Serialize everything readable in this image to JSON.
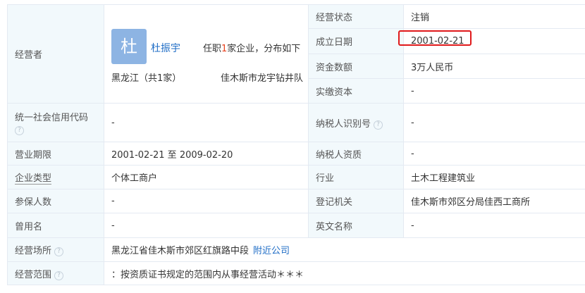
{
  "operator": {
    "label": "经营者",
    "avatar_char": "杜",
    "name": "杜振宇",
    "summary_prefix": "任职",
    "summary_count": "1",
    "summary_suffix": "家企业，分布如下",
    "region": "黑龙江（共1家）",
    "company": "佳木斯市龙宇钻井队"
  },
  "rows": {
    "status": {
      "label": "经营状态",
      "value": "注销"
    },
    "established": {
      "label": "成立日期",
      "value": "2001-02-21"
    },
    "capital": {
      "label": "资金数额",
      "value": "3万人民币"
    },
    "paid_capital": {
      "label": "实缴资本",
      "value": "-"
    },
    "credit_code": {
      "label": "统一社会信用代码",
      "value": "-"
    },
    "taxpayer_id": {
      "label": "纳税人识别号",
      "value": "-"
    },
    "business_term": {
      "label": "营业期限",
      "value": "2001-02-21 至 2009-02-20"
    },
    "taxpayer_qualification": {
      "label": "纳税人资质",
      "value": "-"
    },
    "company_type": {
      "label": "企业类型",
      "value": "个体工商户"
    },
    "industry": {
      "label": "行业",
      "value": "土木工程建筑业"
    },
    "insured_count": {
      "label": "参保人数",
      "value": "-"
    },
    "registration_authority": {
      "label": "登记机关",
      "value": "佳木斯市郊区分局佳西工商所"
    },
    "former_name": {
      "label": "曾用名",
      "value": "-"
    },
    "english_name": {
      "label": "英文名称",
      "value": "-"
    },
    "address": {
      "label": "经营场所",
      "value": "黑龙江省佳木斯市郊区红旗路中段",
      "link": "附近公司"
    },
    "scope": {
      "label": "经营范围",
      "value": "：按资质证书规定的范围内从事经营活动＊＊＊"
    }
  },
  "icons": {
    "help": "question-circle-icon"
  },
  "colors": {
    "label_bg": "#f2f9fc",
    "border": "#e4eaf2",
    "link": "#1f6dc6",
    "highlight": "#e0191b",
    "avatar": "#8db4e3"
  }
}
